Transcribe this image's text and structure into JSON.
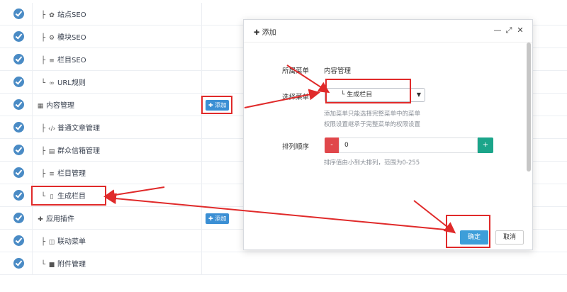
{
  "tree": {
    "rows": [
      {
        "label": "站点SEO",
        "connector": "├",
        "icon": "gear-icon",
        "glyph": "✿"
      },
      {
        "label": "模块SEO",
        "connector": "├",
        "icon": "cogs-icon",
        "glyph": "⚙"
      },
      {
        "label": "栏目SEO",
        "connector": "├",
        "icon": "list-icon",
        "glyph": "≡"
      },
      {
        "label": "URL规则",
        "connector": "└",
        "icon": "link-icon",
        "glyph": "∞"
      },
      {
        "label": "内容管理",
        "connector": "",
        "icon": "grid-icon",
        "glyph": "▦",
        "add": "添加"
      },
      {
        "label": "普通文章管理",
        "connector": "├",
        "icon": "code-icon",
        "glyph": "‹/›"
      },
      {
        "label": "群众信箱管理",
        "connector": "├",
        "icon": "table-icon",
        "glyph": "▤"
      },
      {
        "label": "栏目管理",
        "connector": "├",
        "icon": "list-icon",
        "glyph": "≡"
      },
      {
        "label": "生成栏目",
        "connector": "└",
        "icon": "file-icon",
        "glyph": "▯"
      },
      {
        "label": "应用插件",
        "connector": "",
        "icon": "puzzle-icon",
        "glyph": "✚",
        "add": "添加"
      },
      {
        "label": "联动菜单",
        "connector": "├",
        "icon": "columns-icon",
        "glyph": "◫"
      },
      {
        "label": "附件管理",
        "connector": "└",
        "icon": "folder-icon",
        "glyph": "■"
      }
    ]
  },
  "modal": {
    "title": "添加",
    "title_icon": "plus-icon",
    "parent_label": "所属菜单",
    "parent_value": "内容管理",
    "select_label": "选择菜单",
    "select_value": "└ 生成栏目",
    "help_line1": "添加菜单只能选择完整菜单中的菜单",
    "help_line2": "权限设置继承于完整菜单的权限设置",
    "order_label": "排列顺序",
    "minus": "-",
    "order_value": "0",
    "plus": "+",
    "order_help": "排序值由小到大排列，范围为0-255",
    "confirm": "确定",
    "cancel": "取消"
  },
  "colors": {
    "check": "#4a8bc5",
    "add_button": "#3b8fd4",
    "minus_button": "#e0474b",
    "plus_button": "#1ba58a",
    "confirm_button": "#3d9ed9",
    "annotation": "#e02a2a"
  }
}
